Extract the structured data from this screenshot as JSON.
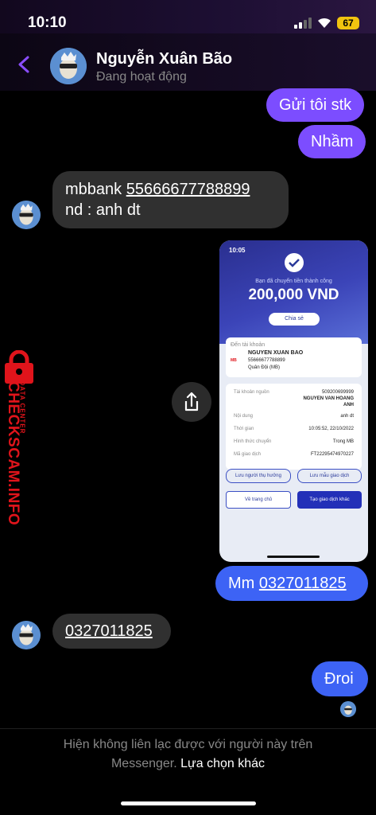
{
  "status": {
    "time": "10:10",
    "battery": "67"
  },
  "header": {
    "name": "Nguyễn Xuân Bão",
    "presence": "Đang hoạt động"
  },
  "messages": {
    "m1": "Gửi tôi stk",
    "m2": "Nhầm",
    "m3_line1_prefix": "mbbank ",
    "m3_line1_link": "55666677788899",
    "m3_line2": "nd : anh dt",
    "m4_prefix": "Mm ",
    "m4_link": "0327011825",
    "m5_link": "0327011825",
    "m6": "Đroi"
  },
  "receipt": {
    "time": "10:05",
    "title": "Bạn đã chuyển tiền thành công",
    "amount": "200,000 VND",
    "share": "Chia sẻ",
    "to_label": "Đến tài khoản",
    "to_name": "NGUYEN XUAN BAO",
    "to_account": "55666677788899",
    "to_bank": "Quân Đội (MB)",
    "bank_badge": "MB",
    "src_label": "Tài khoản nguồn",
    "src_account": "509200699999",
    "src_name1": "NGUYEN VAN HOANG",
    "src_name2": "ANH",
    "content_label": "Nội dung",
    "content_value": "anh dt",
    "time_label": "Thời gian",
    "time_value": "10:05:52, 22/10/2022",
    "method_label": "Hình thức chuyển",
    "method_value": "Trong MB",
    "txn_label": "Mã giao dịch",
    "txn_value": "FT22295474970227",
    "save_recipient": "Lưu người thụ hưởng",
    "save_template": "Lưu mẫu giao dịch",
    "home_btn": "Về trang chủ",
    "new_txn_btn": "Tạo giao dịch khác"
  },
  "watermark": {
    "brand": "CHECKSCAM.INFO",
    "sub": "DATA CENTER"
  },
  "footer": {
    "line1": "Hiện không liên lạc được với người này trên",
    "line2_prefix": "Messenger. ",
    "line2_action": "Lựa chọn khác"
  },
  "colors": {
    "outgoing": "#7c4dff",
    "outgoing_blue": "#3d63f5",
    "incoming": "#303030",
    "accent": "#7c4dff",
    "watermark": "#e0141b"
  }
}
